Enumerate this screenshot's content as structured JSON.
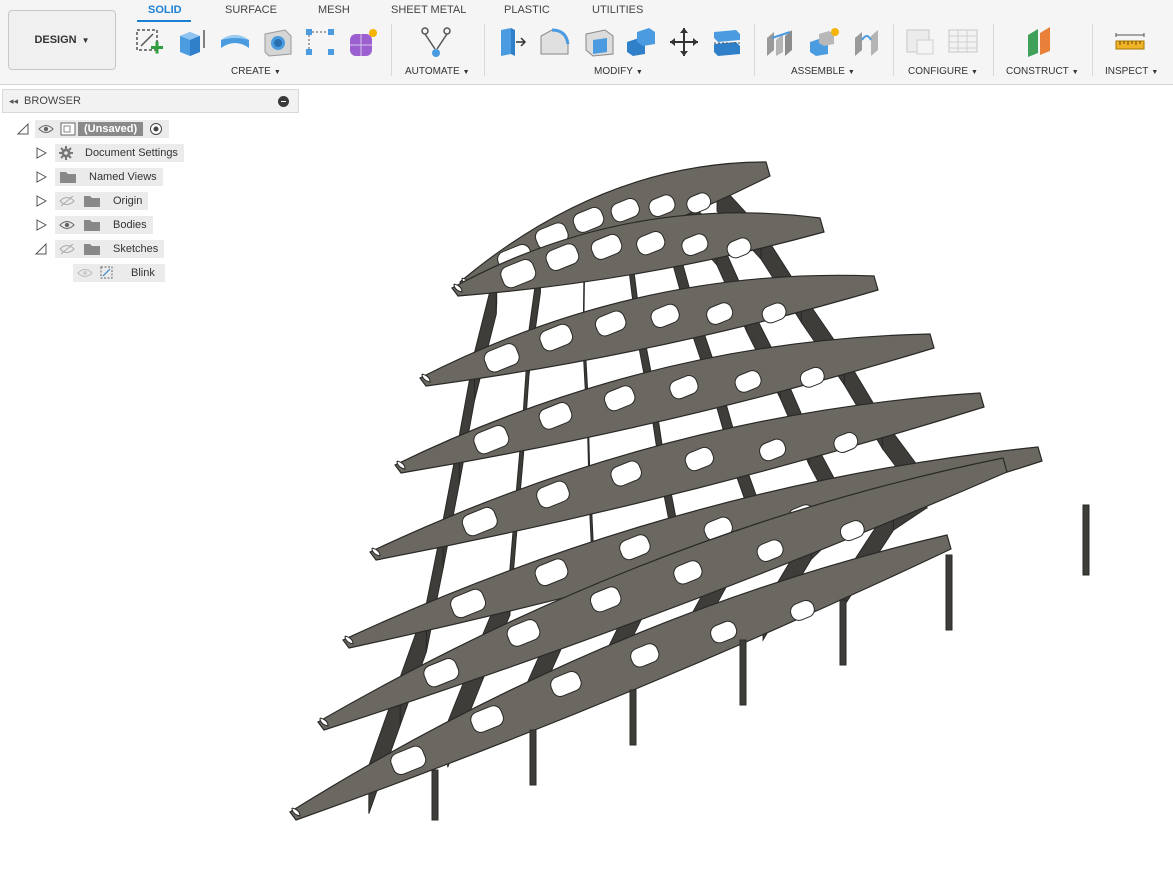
{
  "design_menu": {
    "label": "DESIGN"
  },
  "tabs": [
    {
      "label": "SOLID",
      "active": true
    },
    {
      "label": "SURFACE",
      "active": false
    },
    {
      "label": "MESH",
      "active": false
    },
    {
      "label": "SHEET METAL",
      "active": false
    },
    {
      "label": "PLASTIC",
      "active": false
    },
    {
      "label": "UTILITIES",
      "active": false
    }
  ],
  "groups": {
    "create": "CREATE",
    "automate": "AUTOMATE",
    "modify": "MODIFY",
    "assemble": "ASSEMBLE",
    "configure": "CONFIGURE",
    "construct": "CONSTRUCT",
    "inspect": "INSPECT"
  },
  "browser": {
    "title": "BROWSER",
    "root": "(Unsaved)",
    "items": [
      {
        "label": "Document Settings"
      },
      {
        "label": "Named Views"
      },
      {
        "label": "Origin"
      },
      {
        "label": "Bodies"
      },
      {
        "label": "Sketches"
      },
      {
        "label": "Blink"
      }
    ]
  },
  "colors": {
    "accent": "#1b7fd4",
    "model_fill": "#6b6862",
    "model_dark": "#3f3d3a",
    "model_edge": "#2a2927"
  },
  "icons": [
    "create-sketch-icon",
    "extrude-icon",
    "revolve-icon",
    "hole-icon",
    "pattern-icon",
    "form-icon",
    "automate-icon",
    "press-pull-icon",
    "fillet-icon",
    "shell-icon",
    "combine-icon",
    "move-icon",
    "align-icon",
    "joint-icon",
    "new-component-icon",
    "as-built-joint-icon",
    "configure-icon",
    "table-icon",
    "offset-plane-icon",
    "measure-icon"
  ]
}
